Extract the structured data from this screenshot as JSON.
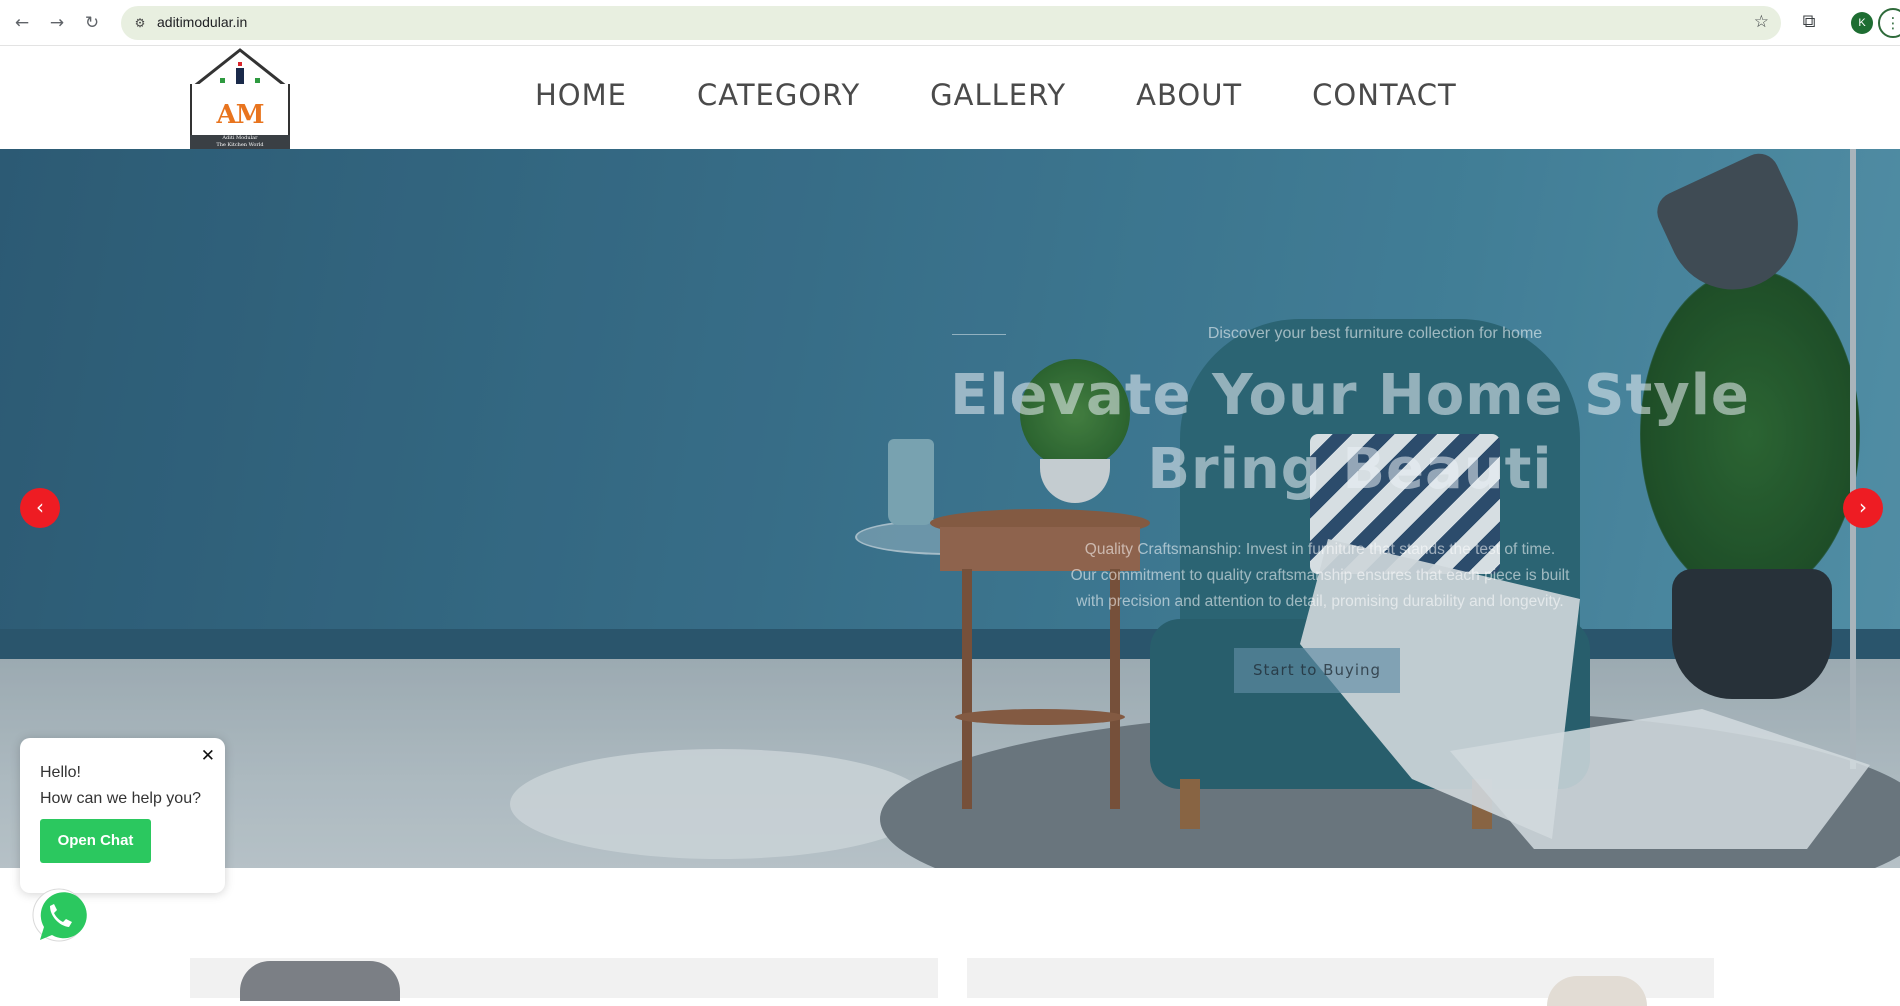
{
  "browser": {
    "back_icon": "back-arrow-icon",
    "forward_icon": "forward-arrow-icon",
    "reload_icon": "reload-icon",
    "url": "aditimodular.in",
    "profile_initial": "K"
  },
  "logo": {
    "monogram": "AM",
    "line1": "Aditi Modular",
    "line2": "The Kitchen World"
  },
  "nav": {
    "home": "HOME",
    "category": "CATEGORY",
    "gallery": "GALLERY",
    "about": "ABOUT",
    "contact": "CONTACT"
  },
  "hero": {
    "kicker": "Discover your best furniture collection for home",
    "title_line1": "Elevate Your Home Style",
    "title_line2": "Bring Beauti",
    "desc_line1": "Quality Craftsmanship: Invest in furniture that stands the test of time.",
    "desc_line2": "Our commitment to quality craftsmanship ensures that each piece is built",
    "desc_line3": "with precision and attention to detail, promising durability and longevity.",
    "cta": "Start to Buying",
    "accent_color": "#ee1c23"
  },
  "chat": {
    "greeting_line1": "Hello!",
    "greeting_line2": "How can we help you?",
    "open_label": "Open Chat",
    "close_label": "✕",
    "button_color": "#2bc85f"
  }
}
